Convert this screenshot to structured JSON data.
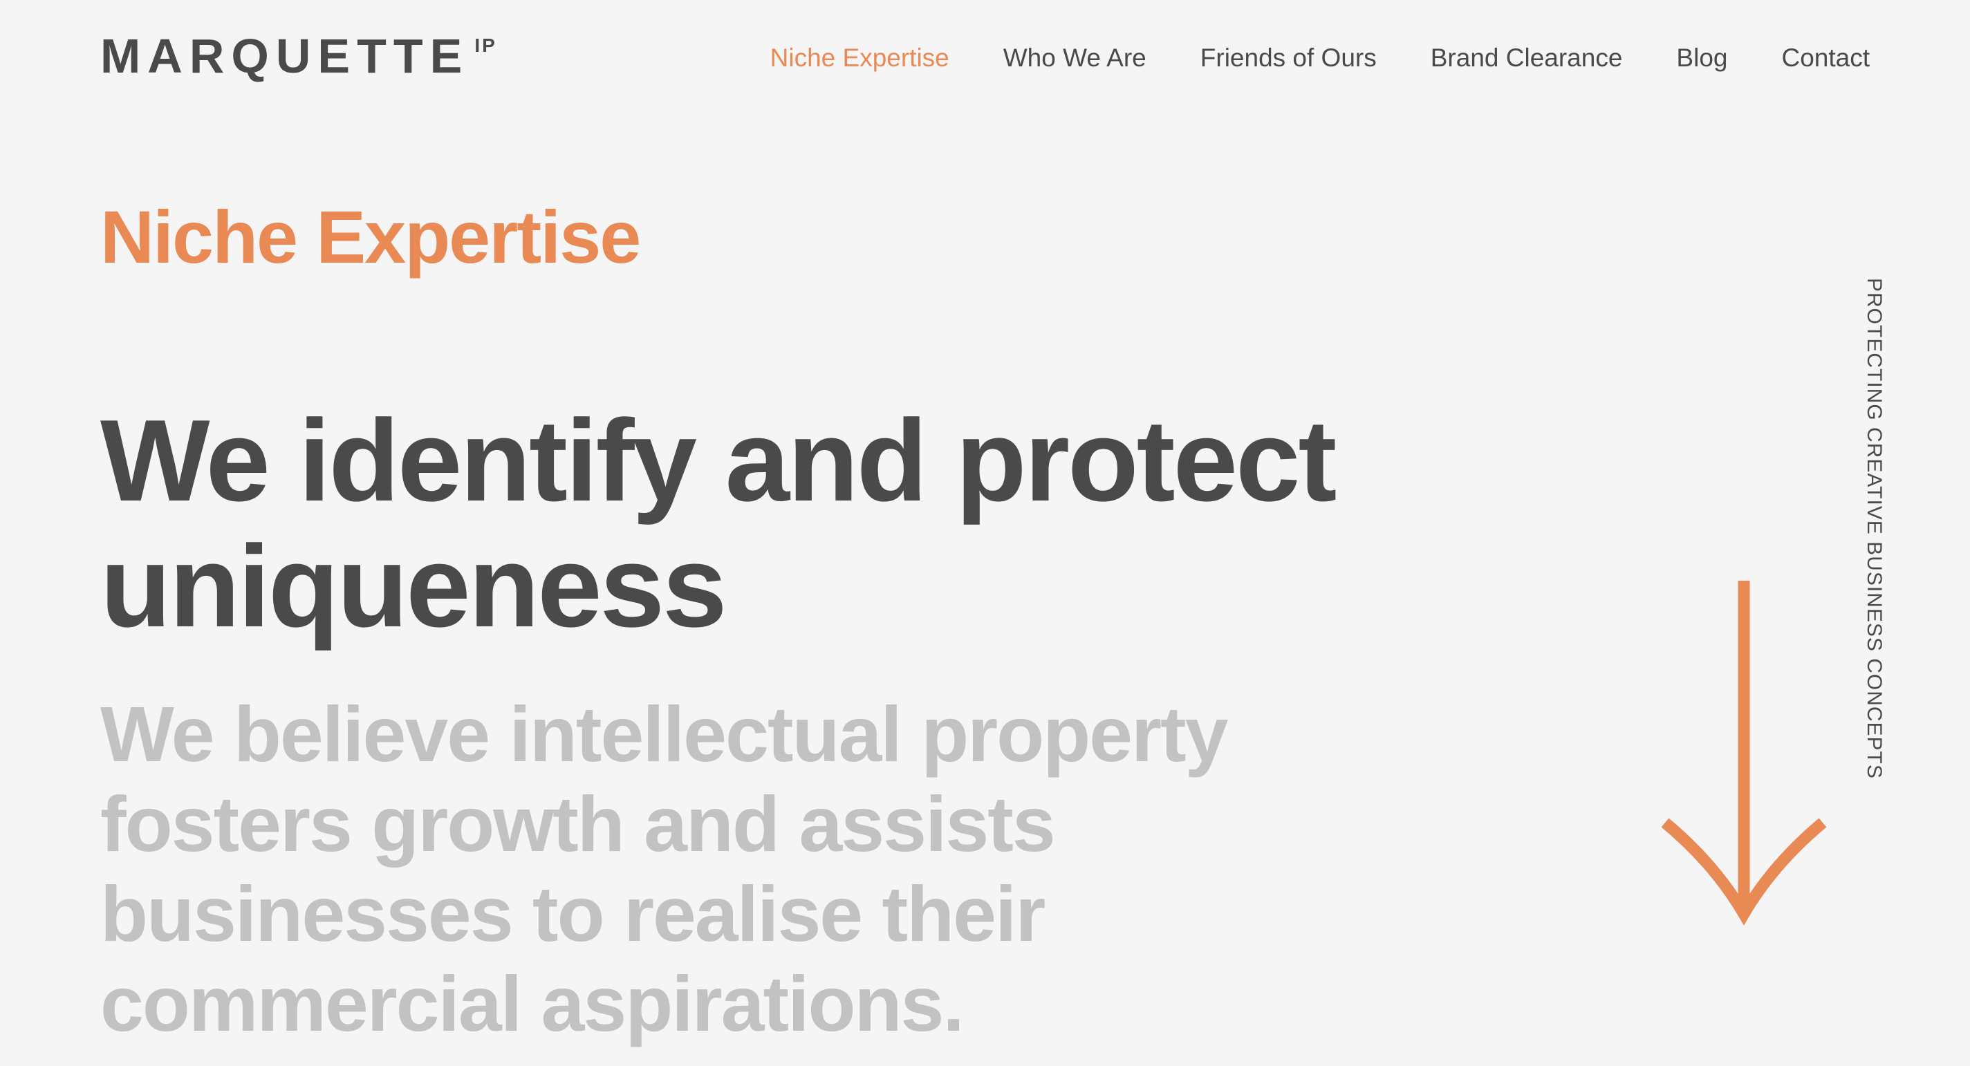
{
  "brand": {
    "logo_text": "MARQUETTE",
    "logo_sup": "IP"
  },
  "nav": {
    "items": [
      {
        "label": "Niche Expertise",
        "active": true
      },
      {
        "label": "Who We Are",
        "active": false
      },
      {
        "label": "Friends of Ours",
        "active": false
      },
      {
        "label": "Brand Clearance",
        "active": false
      },
      {
        "label": "Blog",
        "active": false
      },
      {
        "label": "Contact",
        "active": false
      }
    ]
  },
  "hero": {
    "section_title": "Niche Expertise",
    "headline": "We identify and protect uniqueness",
    "subtext": "We believe intellectual property fosters growth and assists businesses to realise their commercial aspirations.",
    "tagline": "PROTECTING CREATIVE BUSINESS CONCEPTS",
    "scroll_icon": "arrow-down-icon"
  },
  "colors": {
    "accent": "#e98a55",
    "text": "#4a4a4a",
    "muted": "#c2c2c2",
    "background": "#f5f5f5"
  }
}
